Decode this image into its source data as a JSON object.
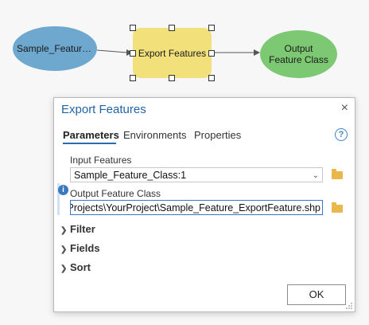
{
  "diagram": {
    "input_node_label": "Sample_Feature_Class",
    "tool_node_label": "Export Features",
    "output_node_label": "Output Feature Class"
  },
  "dialog": {
    "title": "Export Features",
    "close_glyph": "×",
    "tabs": [
      {
        "label": "Parameters",
        "active": true
      },
      {
        "label": "Environments",
        "active": false
      },
      {
        "label": "Properties",
        "active": false
      }
    ],
    "help_glyph": "?",
    "input_features": {
      "label": "Input Features",
      "value": "Sample_Feature_Class:1"
    },
    "output_feature_class": {
      "label": "Output Feature Class",
      "value": "GIS\\Projects\\YourProject\\Sample_Feature_ExportFeature.shp"
    },
    "info_glyph": "i",
    "sections": [
      {
        "label": "Filter"
      },
      {
        "label": "Fields"
      },
      {
        "label": "Sort"
      }
    ],
    "ok_label": "OK"
  },
  "colors": {
    "accent": "#2165a8",
    "input_node": "#6ea8cf",
    "tool_node": "#f2e07a",
    "output_node": "#7cc873"
  }
}
